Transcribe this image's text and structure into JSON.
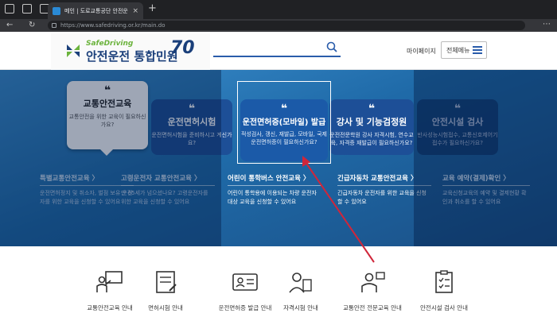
{
  "browser": {
    "tab_title": "메인 | 도로교통공단 안전운전 통",
    "tab_close": "×",
    "new_tab": "+",
    "url": "https://www.safedriving.or.kr/main.do",
    "back": "←",
    "reload": "↻",
    "menu": "⋯"
  },
  "header": {
    "logo_en": "SafeDriving",
    "logo_ko": "안전운전 통합민원",
    "logo_70": "70",
    "mypage": "마이페이지",
    "allmenu": "전체메뉴"
  },
  "cards": [
    {
      "title": "교통안전교육",
      "desc": "교통안전을 위한 교육이 필요하신가요?"
    },
    {
      "title": "운전면허시험",
      "desc": "운전면허시험을 준비하시고 계신가요?"
    },
    {
      "title": "운전면허증(모바일) 발급",
      "desc": "적성검사, 갱신, 재발급, 모바일, 국제운전면허증이 필요하신가요?"
    },
    {
      "title": "강사 및 기능검정원",
      "desc": "운전전문학원 강사 자격시험, 연수교육, 자격증 재발급이 필요하신가요?"
    },
    {
      "title": "안전시설 검사",
      "desc": "반사성능시험접수, 교통신호제어기 접수가 필요하신가요?"
    }
  ],
  "subitems": [
    {
      "title": "특별교통안전교육 〉",
      "desc": "운전면허정지 및 취소자, 벌점 보유 운전자를 위한 교육을 신청할 수 있어요"
    },
    {
      "title": "고령운전자 교통안전교육 〉",
      "desc": "만 65세가 넘으셨나요? 고령운전자를 위한 교육을 신청할 수 있어요"
    },
    {
      "title": "어린이 통학버스 안전교육 〉",
      "desc": "어린이 통학용에 이용되는 차량 운전자 대상 교육을 신청할 수 있어요"
    },
    {
      "title": "긴급자동차 교통안전교육 〉",
      "desc": "긴급자동차 운전자를 위한 교육을 신청할 수 있어요"
    },
    {
      "title": "교육 예약(결제)확인 〉",
      "desc": "교육신청교육의 예약 및 결제현황 확인과 취소를 할 수 있어요"
    }
  ],
  "quick_menu": [
    {
      "label": "교통안전교육 안내",
      "icon": "lecture-icon"
    },
    {
      "label": "면허시험 안내",
      "icon": "exam-icon"
    },
    {
      "label": "운전면허증 발급 안내",
      "icon": "license-card-icon"
    },
    {
      "label": "자격시험 안내",
      "icon": "certificate-exam-icon"
    },
    {
      "label": "교통안전 전문교육 안내",
      "icon": "instructor-icon"
    },
    {
      "label": "안전시설 검사 안내",
      "icon": "checklist-icon"
    }
  ],
  "colors": {
    "hero": "#2f82c4",
    "brand_navy": "#1a3f7a",
    "brand_green": "#6bb33c",
    "annotation_arrow": "#d0263a"
  }
}
